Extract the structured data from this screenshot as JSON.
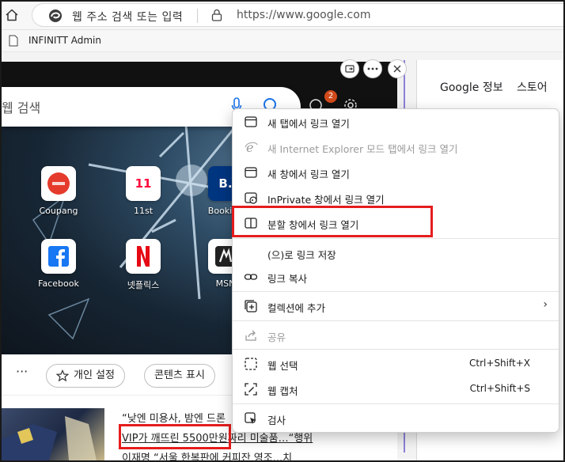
{
  "browser": {
    "address_placeholder": "웹 주소 검색 또는 입력",
    "url": "https://www.google.com",
    "favorites": [
      {
        "label": "INFINITT Admin"
      }
    ]
  },
  "newtab": {
    "search_placeholder": "웹 검색",
    "notification_count": "2",
    "tiles": [
      {
        "label": "Coupang"
      },
      {
        "label": "11st"
      },
      {
        "label": "Booking"
      },
      {
        "label": "Facebook"
      },
      {
        "label": "넷플릭스"
      },
      {
        "label": "MSN"
      }
    ],
    "tile_11st_text": "11",
    "tile_booking_text": "B.",
    "toolbar": {
      "more": "···",
      "personalize": "개인 설정",
      "show_content": "콘텐츠 표시"
    },
    "news": {
      "line1": "“낮엔 미용사, 밤엔 드론",
      "line2": "VIP가 깨뜨린 5500만원짜리 미술품…“행위",
      "line3": "이재명 “서울 한복판에 커피잔 영조...치"
    }
  },
  "side_panel": {
    "links": [
      "Google 정보",
      "스토어"
    ]
  },
  "context_menu": {
    "items": [
      {
        "label": "새 탭에서 링크 열기",
        "icon": "new-tab-icon",
        "disabled": false
      },
      {
        "label": "새 Internet Explorer 모드 탭에서 링크 열기",
        "icon": "ie-icon",
        "disabled": true
      },
      {
        "label": "새 창에서 링크 열기",
        "icon": "new-window-icon",
        "disabled": false
      },
      {
        "label": "InPrivate 창에서 링크 열기",
        "icon": "inprivate-icon",
        "disabled": false
      },
      {
        "label": "분할 창에서 링크 열기",
        "icon": "split-window-icon",
        "disabled": false
      },
      {
        "label": "(으)로 링크 저장",
        "icon": "",
        "disabled": false
      },
      {
        "label": "링크 복사",
        "icon": "link-icon",
        "disabled": false
      },
      {
        "label": "컬렉션에 추가",
        "icon": "collections-icon",
        "disabled": false
      },
      {
        "label": "공유",
        "icon": "share-icon",
        "disabled": true
      },
      {
        "label": "웹 선택",
        "icon": "web-select-icon",
        "disabled": false,
        "shortcut": "Ctrl+Shift+X"
      },
      {
        "label": "웹 캡처",
        "icon": "web-capture-icon",
        "disabled": false,
        "shortcut": "Ctrl+Shift+S"
      },
      {
        "label": "검사",
        "icon": "inspect-icon",
        "disabled": false
      }
    ]
  },
  "colors": {
    "highlight_red": "#e51d1d",
    "accent_purple": "#8a7fd8",
    "notification_orange": "#d14a1b",
    "netflix_red": "#e50914",
    "facebook_blue": "#1877f2",
    "coupang_red": "#e53b2c",
    "elevenst_red": "#ff0038",
    "booking_navy": "#003580"
  }
}
